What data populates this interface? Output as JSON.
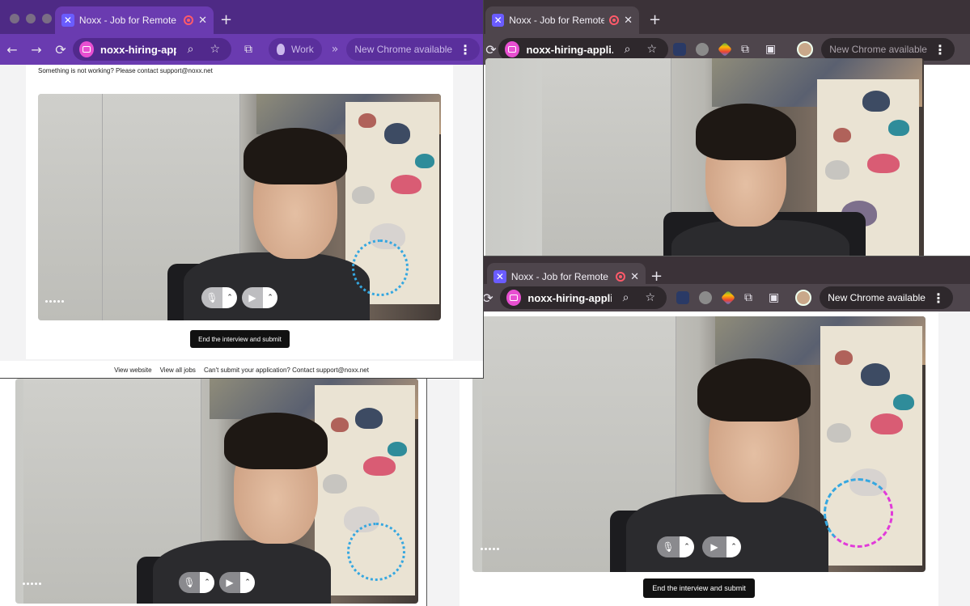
{
  "browser": {
    "tab_title": "Noxx - Job for Remote En",
    "tab_favicon": "✕",
    "url": "noxx-hiring-appli...",
    "url_c": "noxx-hiring-applic...",
    "profile_label": "Work",
    "update_label": "New Chrome available",
    "close_glyph": "✕",
    "new_tab_glyph": "+"
  },
  "page": {
    "help_text": "Something is not working? Please contact support@noxx.net",
    "submit_label": "End the interview and submit"
  },
  "footer": {
    "links": [
      "View website",
      "View all jobs",
      "Can't submit your application? Contact support@noxx.net"
    ]
  },
  "icons": {
    "back": "←",
    "forward": "→",
    "reload": "⟳",
    "zoom": "⌕",
    "star": "☆",
    "extensions": "⧉",
    "more": "⋮",
    "chevron_up": "⌃",
    "mic": "🎙",
    "camera": "▶",
    "double_chevron": "»",
    "cast": "▣"
  },
  "colors": {
    "profile_work": "#6a3bb0",
    "profile_default": "#4e454c",
    "record": "#ff5a6a",
    "site_icon": "#e84fd1",
    "audio_ring": "#35a7e0",
    "audio_peak": "#e13ad9"
  }
}
